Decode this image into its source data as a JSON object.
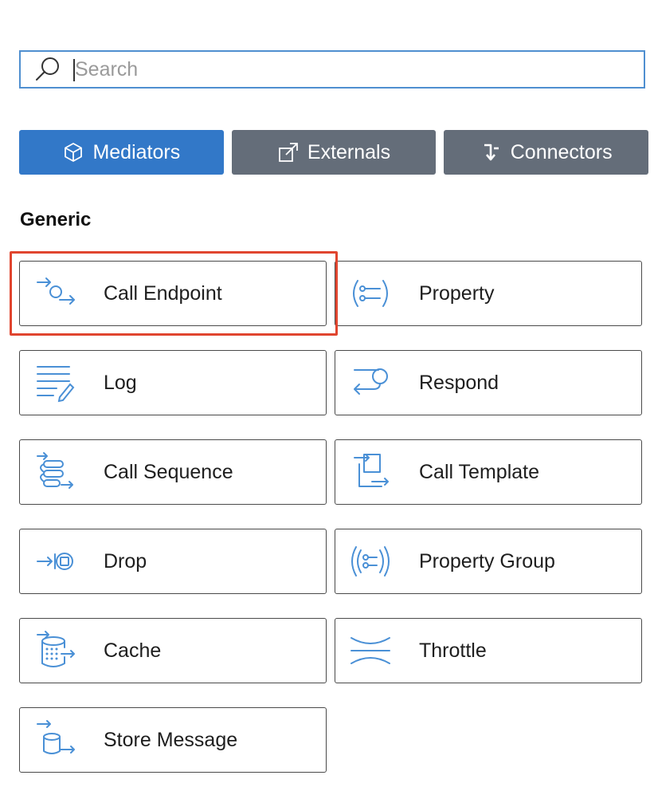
{
  "search": {
    "placeholder": "Search",
    "value": ""
  },
  "tabs": [
    {
      "label": "Mediators",
      "icon": "cube-icon",
      "active": true
    },
    {
      "label": "Externals",
      "icon": "external-link-icon",
      "active": false
    },
    {
      "label": "Connectors",
      "icon": "connector-icon",
      "active": false
    }
  ],
  "section": {
    "title": "Generic"
  },
  "mediators": [
    {
      "label": "Call Endpoint",
      "icon": "call-endpoint-icon",
      "highlighted": true
    },
    {
      "label": "Property",
      "icon": "property-icon"
    },
    {
      "label": "Log",
      "icon": "log-icon"
    },
    {
      "label": "Respond",
      "icon": "respond-icon"
    },
    {
      "label": "Call Sequence",
      "icon": "call-sequence-icon"
    },
    {
      "label": "Call Template",
      "icon": "call-template-icon"
    },
    {
      "label": "Drop",
      "icon": "drop-icon"
    },
    {
      "label": "Property Group",
      "icon": "property-group-icon"
    },
    {
      "label": "Cache",
      "icon": "cache-icon"
    },
    {
      "label": "Throttle",
      "icon": "throttle-icon"
    },
    {
      "label": "Store Message",
      "icon": "store-message-icon"
    }
  ],
  "colors": {
    "accent": "#3278c8",
    "tab_inactive": "#646d79",
    "icon": "#4a90d6",
    "highlight": "#e0452f",
    "search_border": "#4f8fd0"
  }
}
